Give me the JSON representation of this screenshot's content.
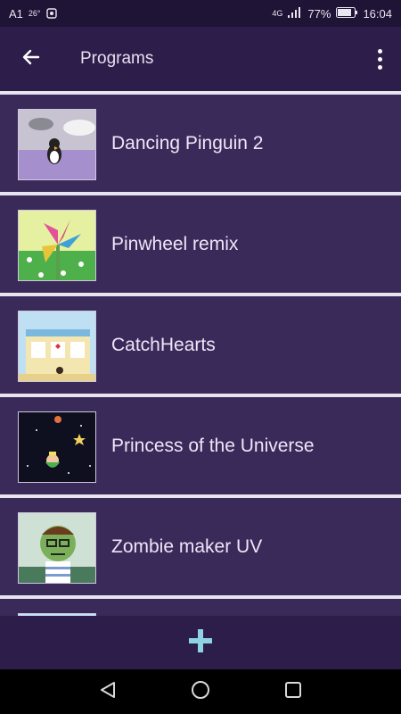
{
  "status_bar": {
    "carrier": "A1",
    "temperature": "26°",
    "network": "4G",
    "battery": "77%",
    "time": "16:04"
  },
  "app_bar": {
    "title": "Programs",
    "back_icon": "arrow-left-icon",
    "menu_icon": "more-vertical-icon"
  },
  "programs": [
    {
      "name": "Dancing Pinguin 2"
    },
    {
      "name": "Pinwheel remix"
    },
    {
      "name": "CatchHearts"
    },
    {
      "name": "Princess of the Universe"
    },
    {
      "name": "Zombie maker UV"
    }
  ],
  "bottom_bar": {
    "add_icon": "plus-icon"
  },
  "colors": {
    "primary": "#2d1d4a",
    "row": "#3a2a5a",
    "divider": "#e8e4ef",
    "text": "#ede6f7",
    "accent": "#8fd2e6"
  }
}
